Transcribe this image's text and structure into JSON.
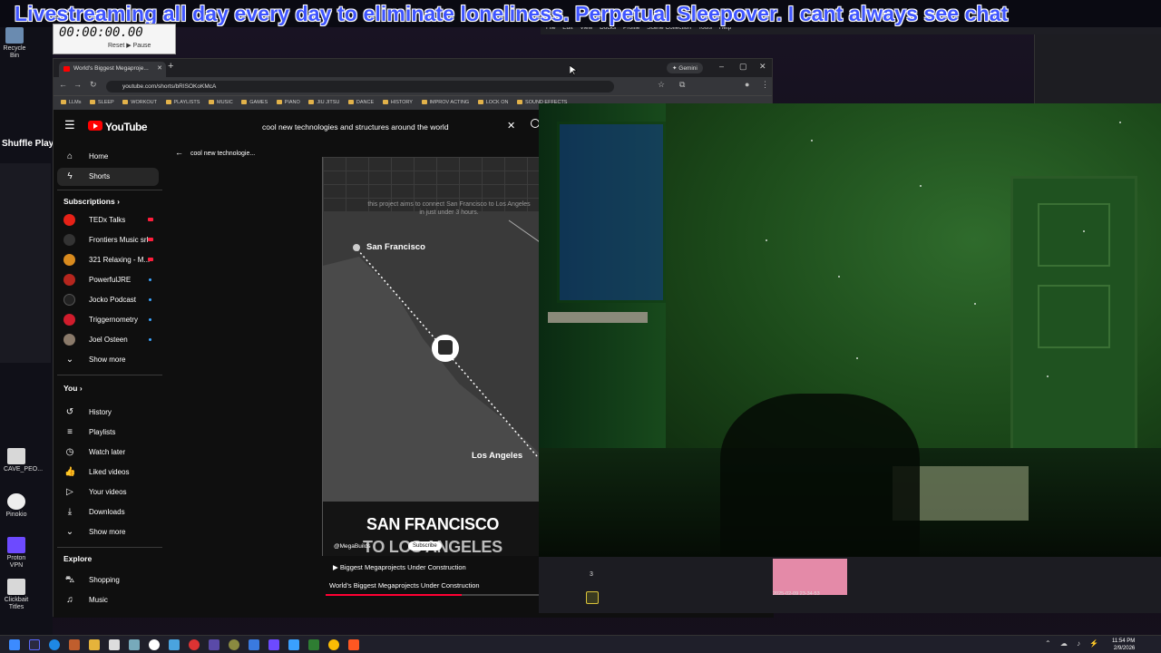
{
  "banner": "Livestreaming all day every day to eliminate loneliness. Perpetual Sleepover. I cant always see chat",
  "timer": {
    "value": "00:00:00.00",
    "buttons": "Reset  ▶ Pause"
  },
  "desktop": {
    "shuffle_label": "Shuffle Playl",
    "icons": [
      "Recycle Bin",
      "CAVE_PEO...",
      "Pinokio",
      "Proton VPN",
      "Clickbait Titles"
    ]
  },
  "obs_menu": [
    "File",
    "Edit",
    "View",
    "Docks",
    "Profile",
    "Scene Collection",
    "Tools",
    "Help"
  ],
  "browser": {
    "tab_title": "World's Biggest Megaproje...",
    "gemini": "Gemini",
    "url": "youtube.com/shorts/bRISOKoKMcA",
    "bookmarks": [
      "LLMs",
      "SLEEP",
      "WORKOUT",
      "PLAYLISTS",
      "MUSIC",
      "GAMES",
      "PIANO",
      "JIU JITSU",
      "DANCE",
      "HISTORY",
      "IMPROV ACTING",
      "LOCK ON",
      "SOUND EFFECTS"
    ]
  },
  "youtube": {
    "logo": "YouTube",
    "search_value": "cool new technologies and structures around the world",
    "back_label": "cool new technologie...",
    "nav": [
      {
        "label": "Home",
        "icon": "home-icon"
      },
      {
        "label": "Shorts",
        "icon": "shorts-icon",
        "active": true
      }
    ],
    "subscriptions_header": "Subscriptions",
    "subscriptions": [
      {
        "label": "TEDx Talks",
        "color": "#e62117",
        "status": "live"
      },
      {
        "label": "Frontiers Music srl",
        "color": "#333333",
        "status": "live"
      },
      {
        "label": "321 Relaxing - M...",
        "color": "#d98b1e",
        "status": "live"
      },
      {
        "label": "PowerfulJRE",
        "color": "#b5261e",
        "status": "new"
      },
      {
        "label": "Jocko Podcast",
        "color": "#222222",
        "status": "new"
      },
      {
        "label": "Triggernometry",
        "color": "#d01c2c",
        "status": "new"
      },
      {
        "label": "Joel Osteen",
        "color": "#8a7a6a",
        "status": "new"
      }
    ],
    "show_more": "Show more",
    "you_header": "You",
    "you_items": [
      {
        "label": "History",
        "icon": "history-icon"
      },
      {
        "label": "Playlists",
        "icon": "playlists-icon"
      },
      {
        "label": "Watch later",
        "icon": "watch-later-icon"
      },
      {
        "label": "Liked videos",
        "icon": "liked-icon"
      },
      {
        "label": "Your videos",
        "icon": "your-videos-icon"
      },
      {
        "label": "Downloads",
        "icon": "downloads-icon"
      }
    ],
    "show_more_2": "Show more",
    "explore_header": "Explore",
    "explore_items": [
      {
        "label": "Shopping",
        "icon": "shopping-icon"
      },
      {
        "label": "Music",
        "icon": "music-icon"
      }
    ],
    "short": {
      "caption": "this project aims to connect San Francisco to Los Angeles in just under 3 hours.",
      "city_a": "San Francisco",
      "city_b": "Los Angeles",
      "headline_1": "SAN FRANCISCO",
      "headline_2": "TO LOS ANGELES",
      "channel": "@MegaBuilds",
      "subscribe": "Subscribe"
    },
    "playlist_row": "Biggest Megaprojects Under Construction",
    "playlist_title": "World's Biggest Megaprojects Under Construction",
    "progress": 0.55
  },
  "obs_bottom": {
    "count": "3",
    "thumb_caption": "2025-02-09 23-34-53"
  },
  "clock": {
    "time": "11:54 PM",
    "date": "2/9/2026"
  }
}
